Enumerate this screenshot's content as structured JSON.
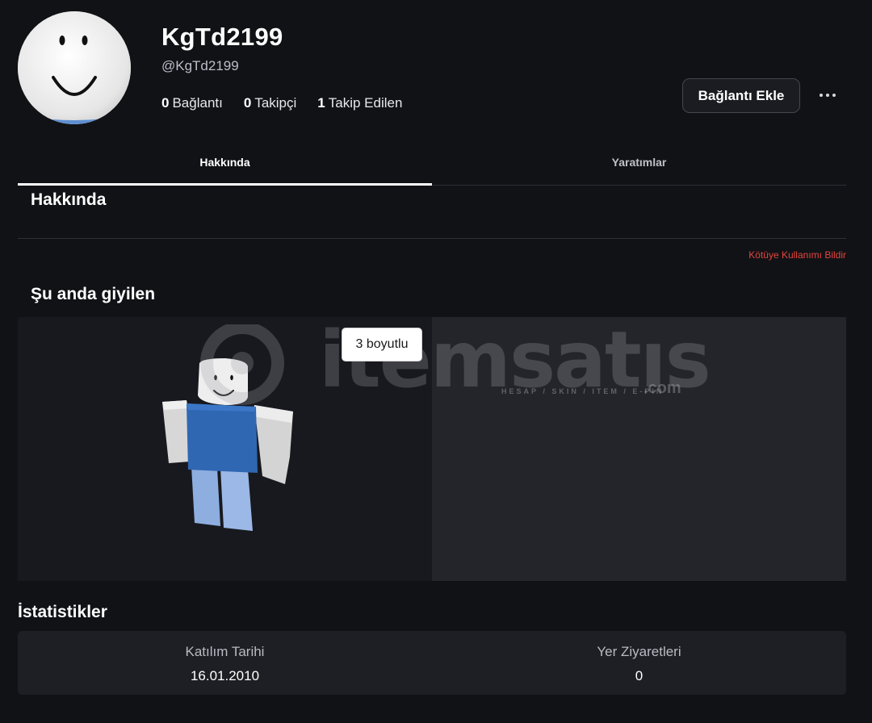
{
  "profile": {
    "display_name": "KgTd2199",
    "username": "@KgTd2199",
    "stats": [
      {
        "count": "0",
        "label": "Bağlantı"
      },
      {
        "count": "0",
        "label": "Takipçi"
      },
      {
        "count": "1",
        "label": "Takip Edilen"
      }
    ],
    "add_connection_label": "Bağlantı Ekle",
    "more_icon": "ellipsis-icon"
  },
  "tabs": [
    "Hakkında",
    "Yaratımlar"
  ],
  "about": {
    "title": "Hakkında",
    "report_label": "Kötüye Kullanımı Bildir"
  },
  "wearing": {
    "title": "Şu anda giyilen",
    "toggle_label": "3 boyutlu"
  },
  "watermark": {
    "text": "itemsatıs",
    "sub": "HESAP / SKIN / ITEM / E-PIN",
    "suffix": ".com"
  },
  "statistics": {
    "title": "İstatistikler",
    "items": [
      {
        "label": "Katılım Tarihi",
        "value": "16.01.2010"
      },
      {
        "label": "Yer Ziyaretleri",
        "value": "0"
      }
    ]
  },
  "colors": {
    "background": "#111216",
    "report_red": "#e4463e",
    "shirt_blue": "#2f67b3",
    "pants_blue": "#8eaee0"
  }
}
